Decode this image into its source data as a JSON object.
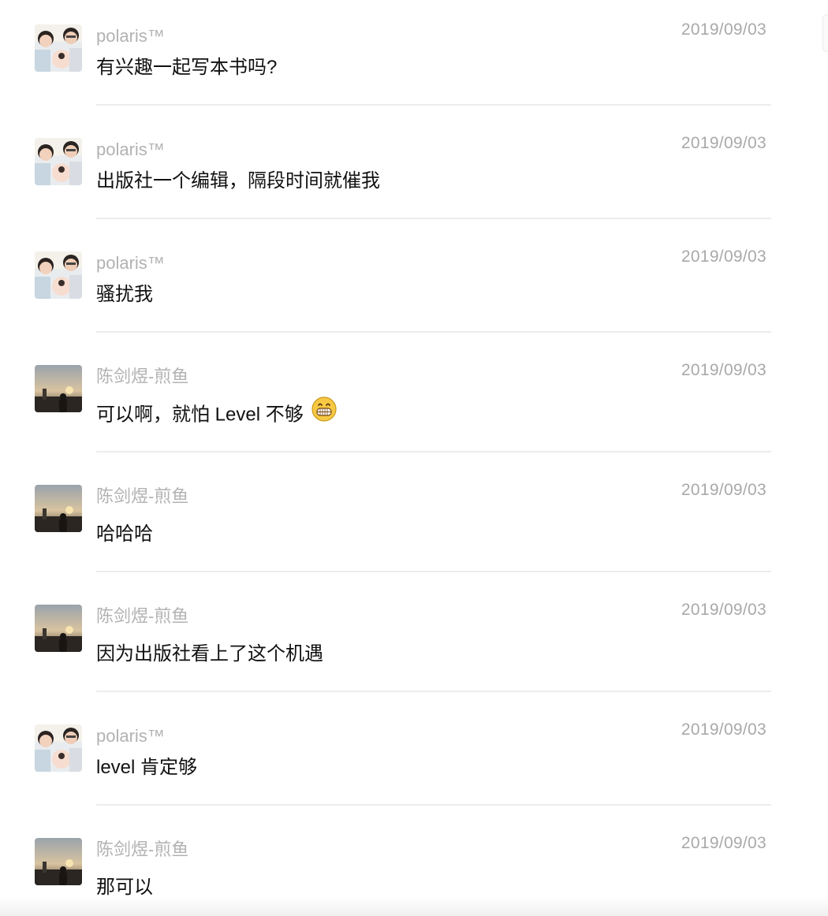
{
  "messages": [
    {
      "sender": "polaris™",
      "avatar": "family-avatar",
      "time": "2019/09/03",
      "text": "有兴趣一起写本书吗?"
    },
    {
      "sender": "polaris™",
      "avatar": "family-avatar",
      "time": "2019/09/03",
      "text": "出版社一个编辑，隔段时间就催我"
    },
    {
      "sender": "polaris™",
      "avatar": "family-avatar",
      "time": "2019/09/03",
      "text": "骚扰我"
    },
    {
      "sender": "陈剑煜-煎鱼",
      "avatar": "sunset-avatar",
      "time": "2019/09/03",
      "text": "可以啊，就怕 Level 不够",
      "emoji": "grinning-face-emoji"
    },
    {
      "sender": "陈剑煜-煎鱼",
      "avatar": "sunset-avatar",
      "time": "2019/09/03",
      "text": "哈哈哈"
    },
    {
      "sender": "陈剑煜-煎鱼",
      "avatar": "sunset-avatar",
      "time": "2019/09/03",
      "text": "因为出版社看上了这个机遇"
    },
    {
      "sender": "polaris™",
      "avatar": "family-avatar",
      "time": "2019/09/03",
      "text": "level 肯定够"
    },
    {
      "sender": "陈剑煜-煎鱼",
      "avatar": "sunset-avatar",
      "time": "2019/09/03",
      "text": "那可以"
    }
  ],
  "colors": {
    "sender_name": "#b2b2b2",
    "timestamp": "#a9a9a9",
    "message_text": "#111111",
    "divider": "#ececec"
  }
}
